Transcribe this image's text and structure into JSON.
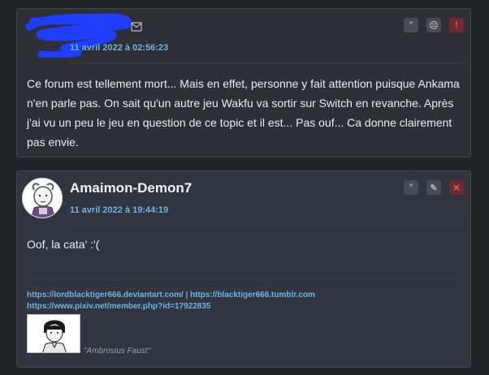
{
  "posts": [
    {
      "author": "",
      "date": "11 avril 2022 à 02:56:23",
      "body": "Ce forum est tellement mort... Mais en effet, personne y fait attention puisque Ankama n'en parle pas. On sait qu'un autre jeu Wakfu va sortir sur Switch en revanche. Après j'ai vu un peu le jeu en question de ce topic et il est... Pas ouf... Ca donne clairement pas envie.",
      "actions": [
        {
          "icon": "quote-icon",
          "glyph": "”"
        },
        {
          "icon": "frown-icon",
          "glyph": "☹"
        },
        {
          "icon": "report-icon",
          "glyph": "!"
        }
      ]
    },
    {
      "author": "Amaimon-Demon7",
      "date": "11 avril 2022 à 19:44:19",
      "body": "Oof, la cata' :'(",
      "actions": [
        {
          "icon": "quote-icon",
          "glyph": "”"
        },
        {
          "icon": "edit-icon",
          "glyph": "✎"
        },
        {
          "icon": "delete-icon",
          "glyph": "✕"
        }
      ],
      "signature": {
        "link1": "https://lordblacktiger666.deviantart.com/",
        "separator": "|",
        "link2": "https://blacktiger666.tumblr.com",
        "link3": "https://www.pixiv.net/member.php?id=17922835",
        "caption": "\"Ambrosius Faust\""
      }
    }
  ],
  "colors": {
    "accent_link": "#6cb4e8",
    "danger": "#e35b63",
    "background": "#212326"
  }
}
